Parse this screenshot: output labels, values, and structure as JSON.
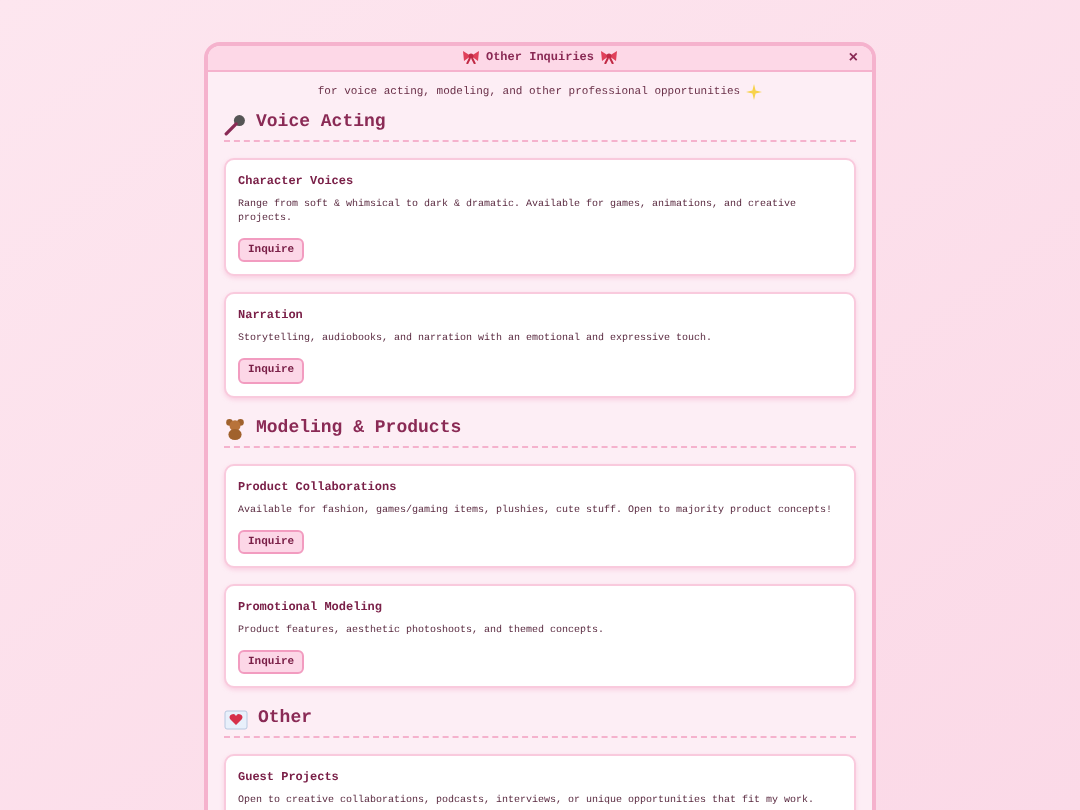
{
  "window": {
    "title": "Other Inquiries",
    "close": "×"
  },
  "subtitle": "for voice acting, modeling, and other professional opportunities",
  "sections": [
    {
      "title": "Voice Acting",
      "cards": [
        {
          "title": "Character Voices",
          "text": "Range from soft & whimsical to dark & dramatic. Available for games, animations, and creative projects.",
          "button": "Inquire"
        },
        {
          "title": "Narration",
          "text": "Storytelling, audiobooks, and narration with an emotional and expressive touch.",
          "button": "Inquire"
        }
      ]
    },
    {
      "title": "Modeling & Products",
      "cards": [
        {
          "title": "Product Collaborations",
          "text": "Available for fashion, games/gaming items, plushies, cute stuff. Open to majority product concepts!",
          "button": "Inquire"
        },
        {
          "title": "Promotional Modeling",
          "text": "Product features, aesthetic photoshoots, and themed concepts.",
          "button": "Inquire"
        }
      ]
    },
    {
      "title": "Other",
      "cards": [
        {
          "title": "Guest Projects",
          "text": "Open to creative collaborations, podcasts, interviews, or unique opportunities that fit my work."
        }
      ]
    }
  ]
}
